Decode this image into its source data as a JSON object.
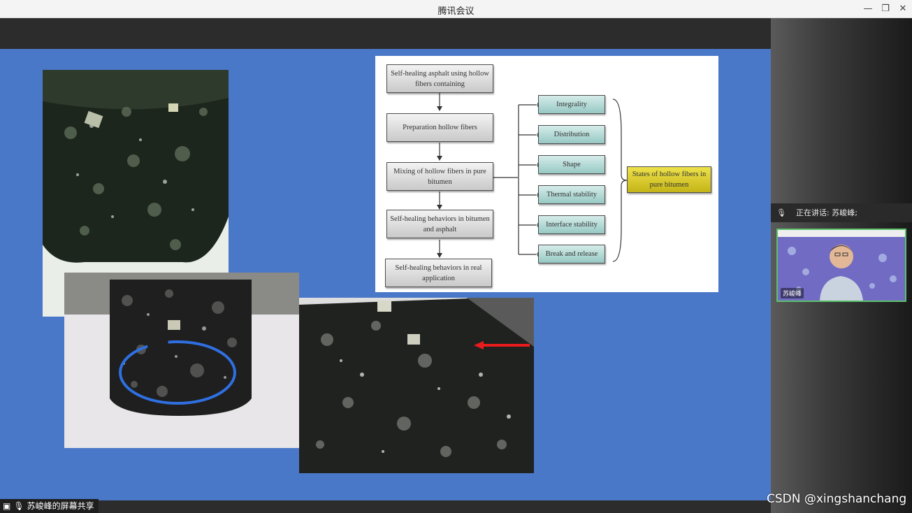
{
  "window": {
    "title": "腾讯会议",
    "minimize_icon": "minimize-icon",
    "restore_icon": "restore-icon",
    "close_icon": "close-icon"
  },
  "flowchart": {
    "steps": [
      "Self-healing asphalt using hollow fibers containing",
      "Preparation hollow fibers",
      "Mixing of hollow fibers in pure bitumen",
      "Self-healing behaviors in bitumen and asphalt",
      "Self-healing behaviors in real application"
    ],
    "properties": [
      "Integrality",
      "Distribution",
      "Shape",
      "Thermal stability",
      "Interface stability",
      "Break and release"
    ],
    "result": "States of hollow fibers in pure bitumen"
  },
  "speaker": {
    "speaking_text": "正在讲话: 苏峻峰;",
    "name": "苏峻峰"
  },
  "share": {
    "label": "苏峻峰的屏幕共享"
  },
  "watermark": "CSDN @xingshanchang",
  "colors": {
    "slide_bg": "#4a78c8",
    "active_speaker_border": "#5bc06a",
    "annotation_blue": "#2f6fe0",
    "annotation_red": "#e81c1c"
  }
}
